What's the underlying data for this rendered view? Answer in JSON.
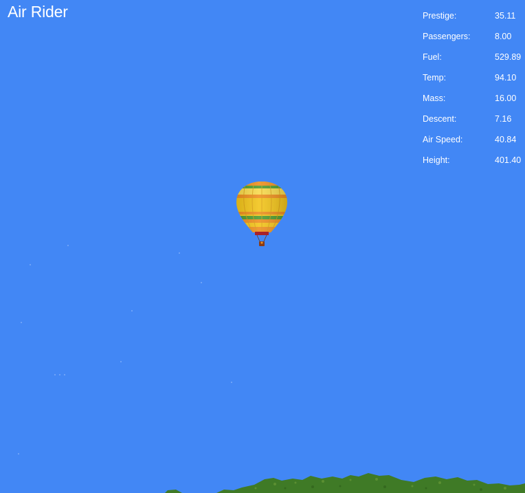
{
  "title": "Air Rider",
  "hud": {
    "prestige": {
      "label": "Prestige:",
      "value": "35.11"
    },
    "passengers": {
      "label": "Passengers:",
      "value": "8.00"
    },
    "fuel": {
      "label": "Fuel:",
      "value": "529.89"
    },
    "temp": {
      "label": "Temp:",
      "value": "94.10"
    },
    "mass": {
      "label": "Mass:",
      "value": "16.00"
    },
    "descent": {
      "label": "Descent:",
      "value": "7.16"
    },
    "air_speed": {
      "label": "Air Speed:",
      "value": "40.84"
    },
    "height": {
      "label": "Height:",
      "value": "401.40"
    }
  },
  "colors": {
    "sky": "#4287f5",
    "balloon_yellow": "#f2c317",
    "balloon_orange": "#ee8d1c",
    "balloon_green": "#4d9a2c",
    "terrain_green": "#3f7a26"
  }
}
